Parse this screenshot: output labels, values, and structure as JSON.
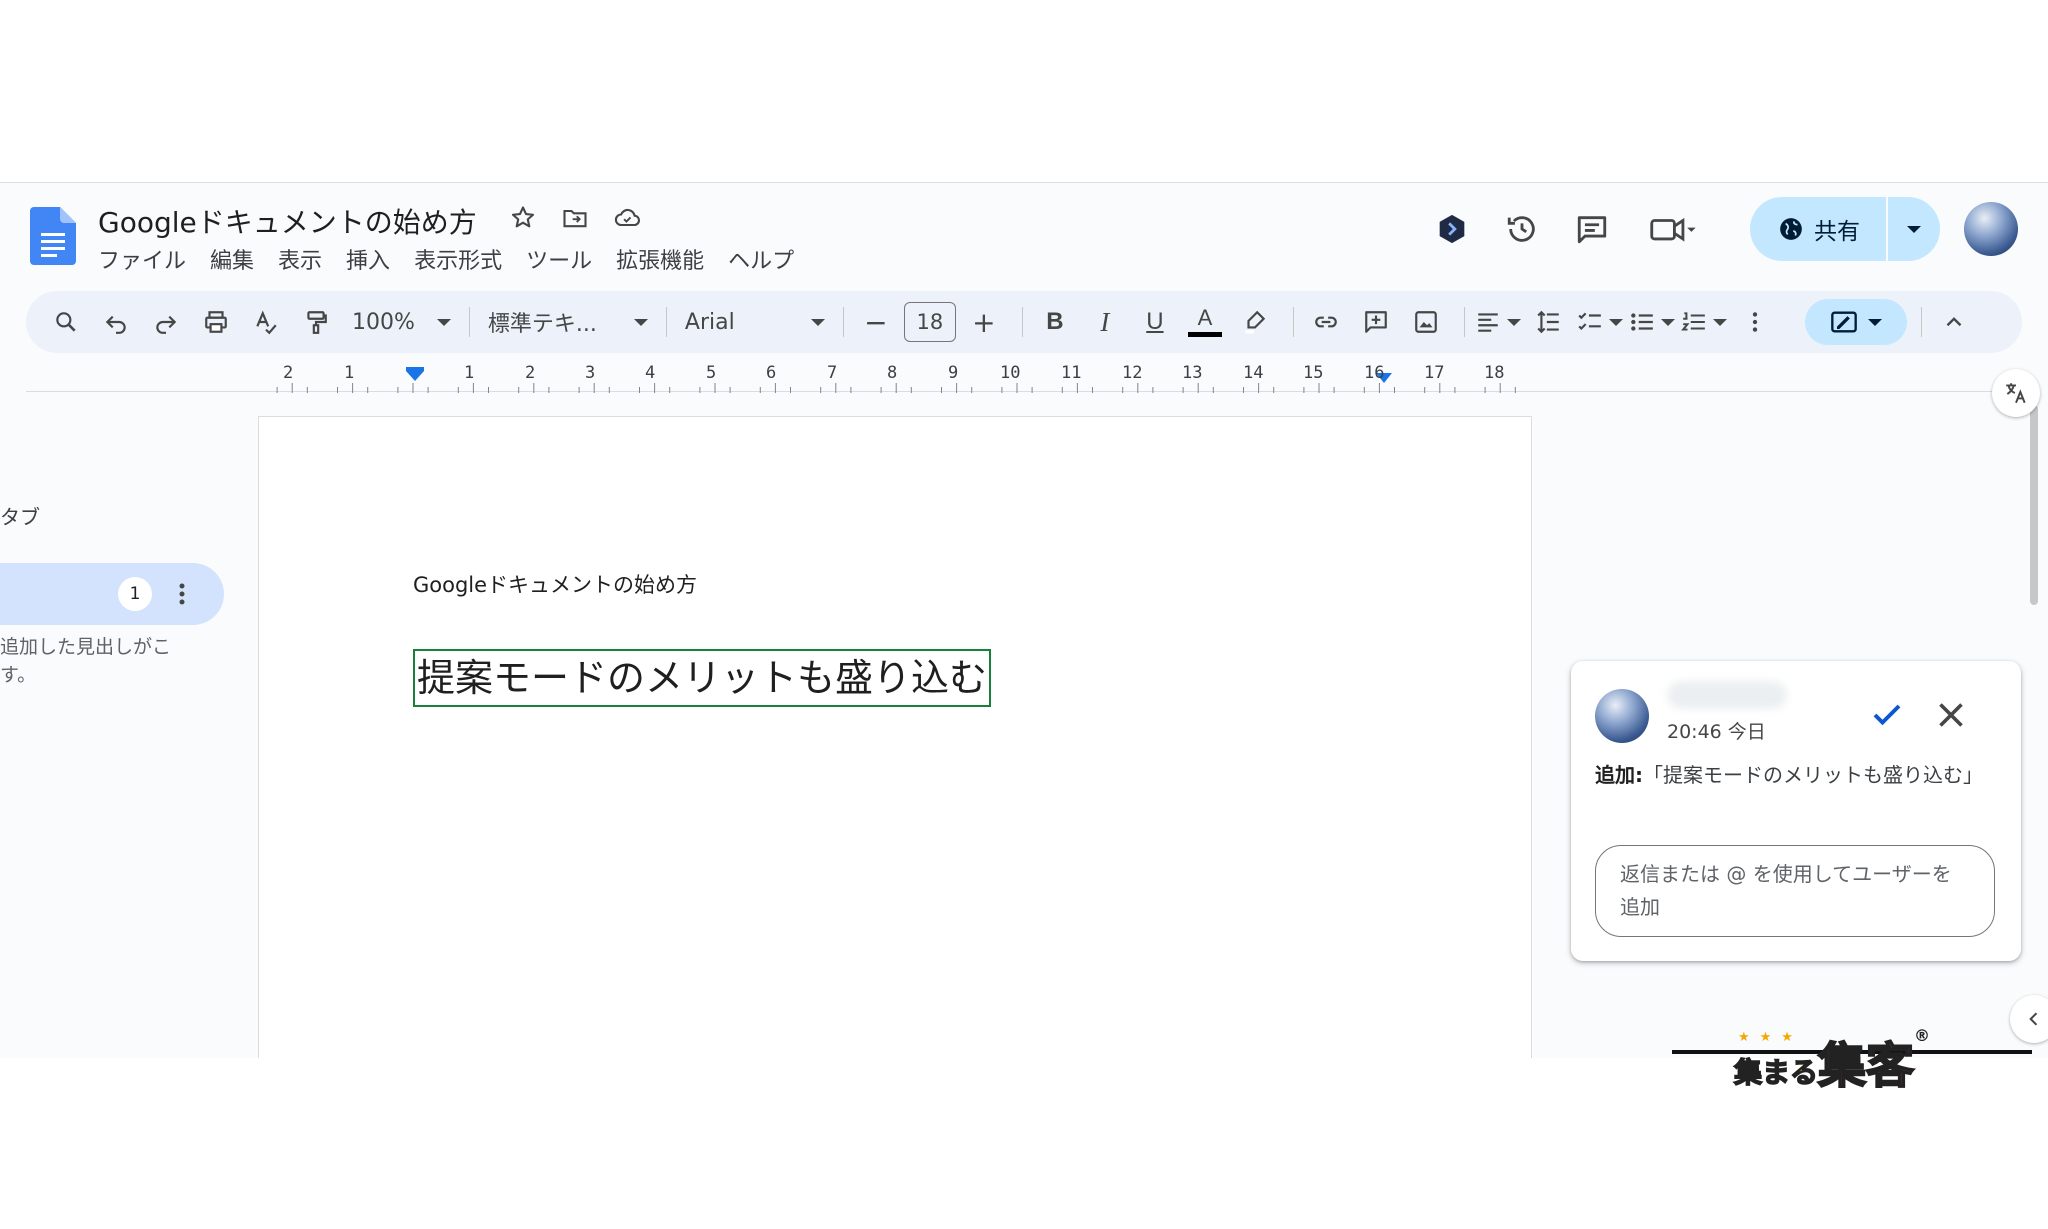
{
  "header": {
    "doc_title": "Googleドキュメントの始め方",
    "menu": [
      "ファイル",
      "編集",
      "表示",
      "挿入",
      "表示形式",
      "ツール",
      "拡張機能",
      "ヘルプ"
    ],
    "share_label": "共有"
  },
  "toolbar": {
    "zoom": "100%",
    "style": "標準テキ...",
    "font": "Arial",
    "font_size": "18",
    "text_color": "#000000",
    "icons": [
      "search-icon",
      "undo-icon",
      "redo-icon",
      "print-icon",
      "spellcheck-icon",
      "paint-format-icon",
      "bold-icon",
      "italic-icon",
      "underline-icon",
      "text-color-icon",
      "highlight-icon",
      "link-icon",
      "add-comment-icon",
      "image-icon",
      "align-icon",
      "line-spacing-icon",
      "checklist-icon",
      "bullet-list-icon",
      "numbered-list-icon",
      "more-icon",
      "suggesting-mode-icon",
      "collapse-menus-icon"
    ]
  },
  "ruler": {
    "numbers": [
      "2",
      "1",
      "1",
      "2",
      "3",
      "4",
      "5",
      "6",
      "7",
      "8",
      "9",
      "10",
      "11",
      "12",
      "13",
      "14",
      "15",
      "16",
      "17",
      "18"
    ]
  },
  "left_panel": {
    "label": "タブ",
    "badge": "1",
    "desc_line1": "追加した見出しがこ",
    "desc_line2": "す。"
  },
  "document": {
    "title_line": "Googleドキュメントの始め方",
    "heading": "提案モードのメリットも盛り込む"
  },
  "comment": {
    "time": "20:46 今日",
    "action_label": "追加:",
    "action_text": "「提案モードのメリットも盛り込む」",
    "reply_placeholder": "返信または @ を使用してユーザーを追加"
  },
  "watermark": {
    "text_small": "集まる",
    "text_big": "集客",
    "registered": "®"
  },
  "colors": {
    "accent": "#0b57d0",
    "share_bg": "#c2e7ff",
    "suggestion_green": "#188038",
    "watermark_pink": "#e7338a",
    "watermark_yellow": "#f6a600"
  }
}
